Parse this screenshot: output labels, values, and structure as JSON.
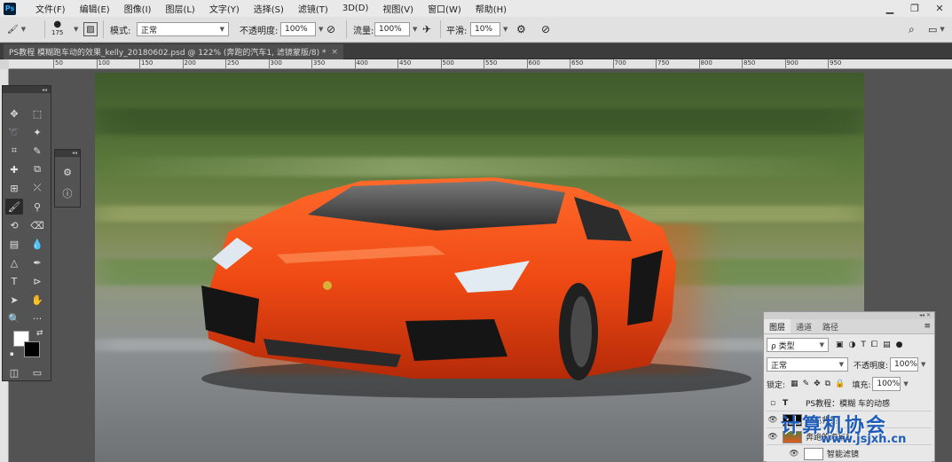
{
  "app": {
    "logo": "Ps"
  },
  "menu": [
    "文件(F)",
    "编辑(E)",
    "图像(I)",
    "图层(L)",
    "文字(Y)",
    "选择(S)",
    "滤镜(T)",
    "3D(D)",
    "视图(V)",
    "窗口(W)",
    "帮助(H)"
  ],
  "window_controls": [
    "minimize-icon",
    "restore-icon",
    "close-icon"
  ],
  "options": {
    "brush_size": "175",
    "mode_label": "模式:",
    "mode_value": "正常",
    "opacity_label": "不透明度:",
    "opacity_value": "100%",
    "flow_label": "流量:",
    "flow_value": "100%",
    "smoothing_label": "平滑:",
    "smoothing_value": "10%"
  },
  "document": {
    "tab_title": "PS教程 模糊跑车动的效果_kelly_20180602.psd @ 122% (奔跑的汽车1, 滤镜蒙版/8) *",
    "close": "×"
  },
  "ruler": [
    "50",
    "100",
    "150",
    "200",
    "250",
    "300",
    "350",
    "400",
    "450",
    "500",
    "550",
    "600",
    "650",
    "700",
    "750",
    "800",
    "850",
    "900",
    "950"
  ],
  "layers_panel": {
    "tabs": [
      "图层",
      "通道",
      "路径"
    ],
    "filter_label": "ρ 类型",
    "blend_mode": "正常",
    "opacity_label": "不透明度:",
    "opacity_value": "100%",
    "lock_label": "锁定:",
    "fill_label": "填充:",
    "fill_value": "100%",
    "layers": [
      {
        "name": "PS教程：模糊 车的动感",
        "type": "T"
      },
      {
        "name": "黑色背景"
      },
      {
        "name": "奔跑的汽车1"
      },
      {
        "name": "智能滤镜"
      }
    ]
  },
  "watermark": {
    "title": "计算机协会",
    "url": "www.jsjxh.cn"
  }
}
